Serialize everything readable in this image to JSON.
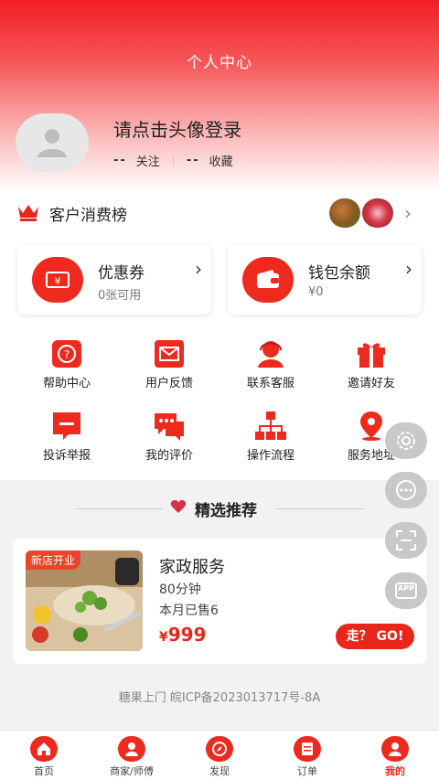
{
  "header": {
    "title": "个人中心"
  },
  "profile": {
    "login_prompt": "请点击头像登录",
    "follow_count": "--",
    "follow_label": "关注",
    "fav_count": "--",
    "fav_label": "收藏"
  },
  "ranking": {
    "label": "客户消费榜"
  },
  "cards": {
    "coupon": {
      "title": "优惠券",
      "subtitle": "0张可用",
      "icon": "coupon-icon"
    },
    "wallet": {
      "title": "钱包余额",
      "subtitle": "¥0",
      "icon": "wallet-icon"
    }
  },
  "menu": [
    {
      "label": "帮助中心",
      "icon": "help-icon"
    },
    {
      "label": "用户反馈",
      "icon": "feedback-icon"
    },
    {
      "label": "联系客服",
      "icon": "customer-service-icon"
    },
    {
      "label": "邀请好友",
      "icon": "gift-icon"
    },
    {
      "label": "投诉举报",
      "icon": "complaint-icon"
    },
    {
      "label": "我的评价",
      "icon": "review-icon"
    },
    {
      "label": "操作流程",
      "icon": "flowchart-icon"
    },
    {
      "label": "服务地址",
      "icon": "location-icon"
    }
  ],
  "recommend": {
    "title": "精选推荐",
    "product": {
      "tag": "新店开业",
      "name": "家政服务",
      "duration": "80分钟",
      "sold": "本月已售6",
      "currency": "¥",
      "price": "999",
      "button": "走？ GO!"
    }
  },
  "footer": {
    "icp": "糖果上门 皖ICP备2023013717号-8A"
  },
  "floating": [
    "settings-icon",
    "chat-icon",
    "scan-icon",
    "app-icon"
  ],
  "floating_app_label": "APP",
  "tabs": [
    {
      "label": "首页",
      "icon": "home-icon"
    },
    {
      "label": "商家/师傅",
      "icon": "merchant-icon"
    },
    {
      "label": "发现",
      "icon": "discover-icon"
    },
    {
      "label": "订单",
      "icon": "order-icon"
    },
    {
      "label": "我的",
      "icon": "profile-icon",
      "active": true
    }
  ],
  "colors": {
    "accent": "#e8261b",
    "header_red": "#f01f24"
  }
}
